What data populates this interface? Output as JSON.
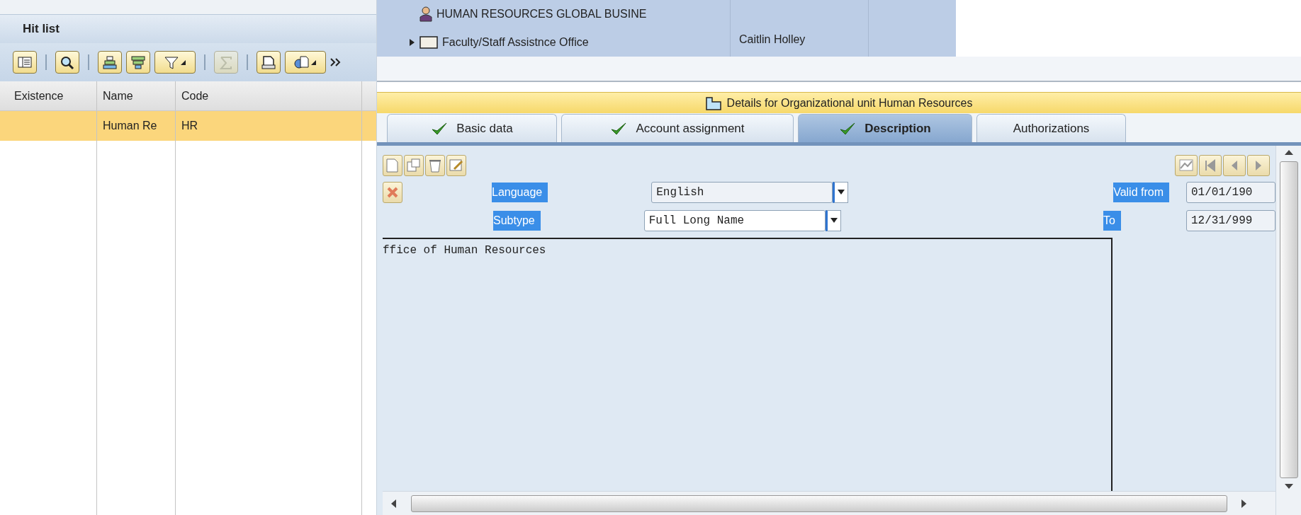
{
  "hit_list": {
    "title": "Hit list",
    "columns": [
      "Existence",
      "Name",
      "Code"
    ],
    "rows": [
      {
        "name": "Human Re",
        "code": "HR",
        "selected": true
      }
    ]
  },
  "org_tree": [
    {
      "kind": "person",
      "label": "HUMAN RESOURCES GLOBAL BUSINE"
    },
    {
      "kind": "org-unit",
      "label": "Faculty/Staff Assistnce Office",
      "expanded": false,
      "manager": "Caitlin Holley"
    }
  ],
  "details_title": "Details for Organizational unit Human Resources",
  "tabs": [
    {
      "label": "Basic data",
      "checked": true,
      "selected": false
    },
    {
      "label": "Account assignment",
      "checked": true,
      "selected": false
    },
    {
      "label": "Description",
      "checked": true,
      "selected": true
    },
    {
      "label": "Authorizations",
      "checked": false,
      "selected": false
    }
  ],
  "form": {
    "language": {
      "label": "Language",
      "value": "English"
    },
    "subtype": {
      "label": "Subtype",
      "value": "Full Long Name"
    },
    "valid_from": {
      "label": "Valid from",
      "value": "01/01/190"
    },
    "to": {
      "label": "To",
      "value": "12/31/999"
    }
  },
  "description_text": "ffice of Human Resources"
}
